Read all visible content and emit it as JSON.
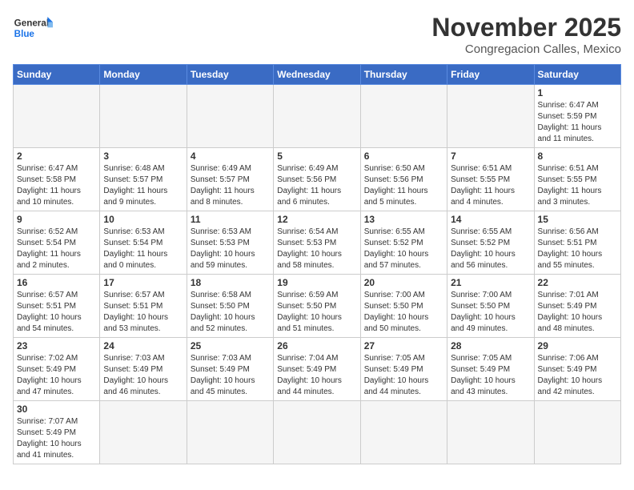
{
  "header": {
    "logo_general": "General",
    "logo_blue": "Blue",
    "month_title": "November 2025",
    "location": "Congregacion Calles, Mexico"
  },
  "weekdays": [
    "Sunday",
    "Monday",
    "Tuesday",
    "Wednesday",
    "Thursday",
    "Friday",
    "Saturday"
  ],
  "weeks": [
    [
      {
        "day": "",
        "info": ""
      },
      {
        "day": "",
        "info": ""
      },
      {
        "day": "",
        "info": ""
      },
      {
        "day": "",
        "info": ""
      },
      {
        "day": "",
        "info": ""
      },
      {
        "day": "",
        "info": ""
      },
      {
        "day": "1",
        "info": "Sunrise: 6:47 AM\nSunset: 5:59 PM\nDaylight: 11 hours\nand 11 minutes."
      }
    ],
    [
      {
        "day": "2",
        "info": "Sunrise: 6:47 AM\nSunset: 5:58 PM\nDaylight: 11 hours\nand 10 minutes."
      },
      {
        "day": "3",
        "info": "Sunrise: 6:48 AM\nSunset: 5:57 PM\nDaylight: 11 hours\nand 9 minutes."
      },
      {
        "day": "4",
        "info": "Sunrise: 6:49 AM\nSunset: 5:57 PM\nDaylight: 11 hours\nand 8 minutes."
      },
      {
        "day": "5",
        "info": "Sunrise: 6:49 AM\nSunset: 5:56 PM\nDaylight: 11 hours\nand 6 minutes."
      },
      {
        "day": "6",
        "info": "Sunrise: 6:50 AM\nSunset: 5:56 PM\nDaylight: 11 hours\nand 5 minutes."
      },
      {
        "day": "7",
        "info": "Sunrise: 6:51 AM\nSunset: 5:55 PM\nDaylight: 11 hours\nand 4 minutes."
      },
      {
        "day": "8",
        "info": "Sunrise: 6:51 AM\nSunset: 5:55 PM\nDaylight: 11 hours\nand 3 minutes."
      }
    ],
    [
      {
        "day": "9",
        "info": "Sunrise: 6:52 AM\nSunset: 5:54 PM\nDaylight: 11 hours\nand 2 minutes."
      },
      {
        "day": "10",
        "info": "Sunrise: 6:53 AM\nSunset: 5:54 PM\nDaylight: 11 hours\nand 0 minutes."
      },
      {
        "day": "11",
        "info": "Sunrise: 6:53 AM\nSunset: 5:53 PM\nDaylight: 10 hours\nand 59 minutes."
      },
      {
        "day": "12",
        "info": "Sunrise: 6:54 AM\nSunset: 5:53 PM\nDaylight: 10 hours\nand 58 minutes."
      },
      {
        "day": "13",
        "info": "Sunrise: 6:55 AM\nSunset: 5:52 PM\nDaylight: 10 hours\nand 57 minutes."
      },
      {
        "day": "14",
        "info": "Sunrise: 6:55 AM\nSunset: 5:52 PM\nDaylight: 10 hours\nand 56 minutes."
      },
      {
        "day": "15",
        "info": "Sunrise: 6:56 AM\nSunset: 5:51 PM\nDaylight: 10 hours\nand 55 minutes."
      }
    ],
    [
      {
        "day": "16",
        "info": "Sunrise: 6:57 AM\nSunset: 5:51 PM\nDaylight: 10 hours\nand 54 minutes."
      },
      {
        "day": "17",
        "info": "Sunrise: 6:57 AM\nSunset: 5:51 PM\nDaylight: 10 hours\nand 53 minutes."
      },
      {
        "day": "18",
        "info": "Sunrise: 6:58 AM\nSunset: 5:50 PM\nDaylight: 10 hours\nand 52 minutes."
      },
      {
        "day": "19",
        "info": "Sunrise: 6:59 AM\nSunset: 5:50 PM\nDaylight: 10 hours\nand 51 minutes."
      },
      {
        "day": "20",
        "info": "Sunrise: 7:00 AM\nSunset: 5:50 PM\nDaylight: 10 hours\nand 50 minutes."
      },
      {
        "day": "21",
        "info": "Sunrise: 7:00 AM\nSunset: 5:50 PM\nDaylight: 10 hours\nand 49 minutes."
      },
      {
        "day": "22",
        "info": "Sunrise: 7:01 AM\nSunset: 5:49 PM\nDaylight: 10 hours\nand 48 minutes."
      }
    ],
    [
      {
        "day": "23",
        "info": "Sunrise: 7:02 AM\nSunset: 5:49 PM\nDaylight: 10 hours\nand 47 minutes."
      },
      {
        "day": "24",
        "info": "Sunrise: 7:03 AM\nSunset: 5:49 PM\nDaylight: 10 hours\nand 46 minutes."
      },
      {
        "day": "25",
        "info": "Sunrise: 7:03 AM\nSunset: 5:49 PM\nDaylight: 10 hours\nand 45 minutes."
      },
      {
        "day": "26",
        "info": "Sunrise: 7:04 AM\nSunset: 5:49 PM\nDaylight: 10 hours\nand 44 minutes."
      },
      {
        "day": "27",
        "info": "Sunrise: 7:05 AM\nSunset: 5:49 PM\nDaylight: 10 hours\nand 44 minutes."
      },
      {
        "day": "28",
        "info": "Sunrise: 7:05 AM\nSunset: 5:49 PM\nDaylight: 10 hours\nand 43 minutes."
      },
      {
        "day": "29",
        "info": "Sunrise: 7:06 AM\nSunset: 5:49 PM\nDaylight: 10 hours\nand 42 minutes."
      }
    ],
    [
      {
        "day": "30",
        "info": "Sunrise: 7:07 AM\nSunset: 5:49 PM\nDaylight: 10 hours\nand 41 minutes."
      },
      {
        "day": "",
        "info": ""
      },
      {
        "day": "",
        "info": ""
      },
      {
        "day": "",
        "info": ""
      },
      {
        "day": "",
        "info": ""
      },
      {
        "day": "",
        "info": ""
      },
      {
        "day": "",
        "info": ""
      }
    ]
  ]
}
